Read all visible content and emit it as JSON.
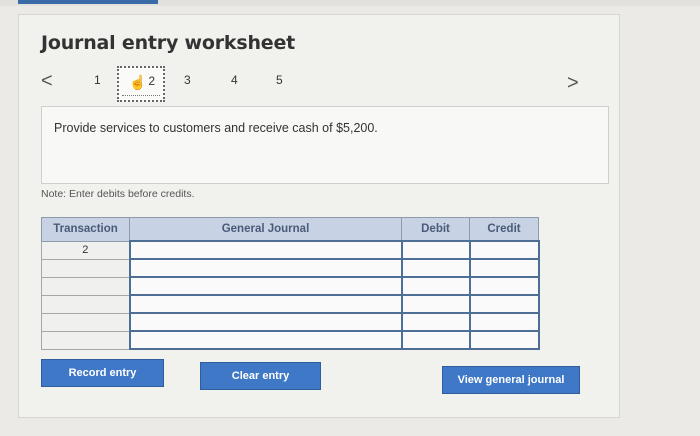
{
  "worksheet": {
    "title": "Journal entry worksheet",
    "steps": [
      "1",
      "2",
      "3",
      "4",
      "5"
    ],
    "active_step": "2",
    "prev_glyph": "<",
    "next_glyph": ">"
  },
  "prompt": "Provide services to customers and receive cash of $5,200.",
  "note": "Note: Enter debits before credits.",
  "table": {
    "headers": {
      "transaction": "Transaction",
      "general_journal": "General Journal",
      "debit": "Debit",
      "credit": "Credit"
    },
    "rows": [
      {
        "transaction": "2",
        "account": "",
        "debit": "",
        "credit": ""
      },
      {
        "transaction": "",
        "account": "",
        "debit": "",
        "credit": ""
      },
      {
        "transaction": "",
        "account": "",
        "debit": "",
        "credit": ""
      },
      {
        "transaction": "",
        "account": "",
        "debit": "",
        "credit": ""
      },
      {
        "transaction": "",
        "account": "",
        "debit": "",
        "credit": ""
      },
      {
        "transaction": "",
        "account": "",
        "debit": "",
        "credit": ""
      }
    ]
  },
  "buttons": {
    "record": "Record entry",
    "clear": "Clear entry",
    "view": "View general journal"
  },
  "colors": {
    "button_blue": "#3f78c6",
    "header_bg": "#c7d3e4"
  }
}
